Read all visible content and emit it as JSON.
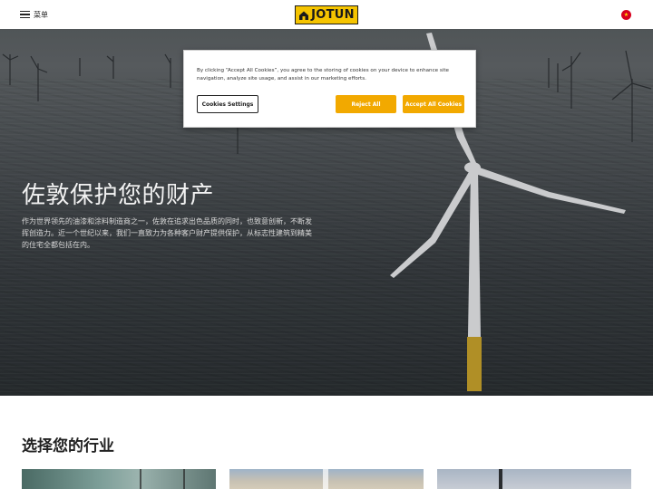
{
  "header": {
    "menu_label": "菜单",
    "logo_text": "JOTUN",
    "language_flag": "china-flag-icon"
  },
  "hero": {
    "title": "佐敦保护您的财产",
    "description": "作为世界领先的油漆和涂料制造商之一，佐敦在追求出色品质的同时，也致意创新，不断发挥创造力。近一个世纪以来，我们一直致力为各种客户财产提供保护，从标志性建筑到精美的住宅全都包括在内。"
  },
  "cookie_banner": {
    "text": "By clicking “Accept All Cookies”, you agree to the storing of cookies on your device to enhance site navigation, analyze site usage, and assist in our marketing efforts.",
    "settings_label": "Cookies Settings",
    "reject_label": "Reject All",
    "accept_label": "Accept All Cookies"
  },
  "industry": {
    "title": "选择您的行业"
  },
  "colors": {
    "brand_yellow": "#f5c400",
    "button_orange": "#f2a900"
  }
}
